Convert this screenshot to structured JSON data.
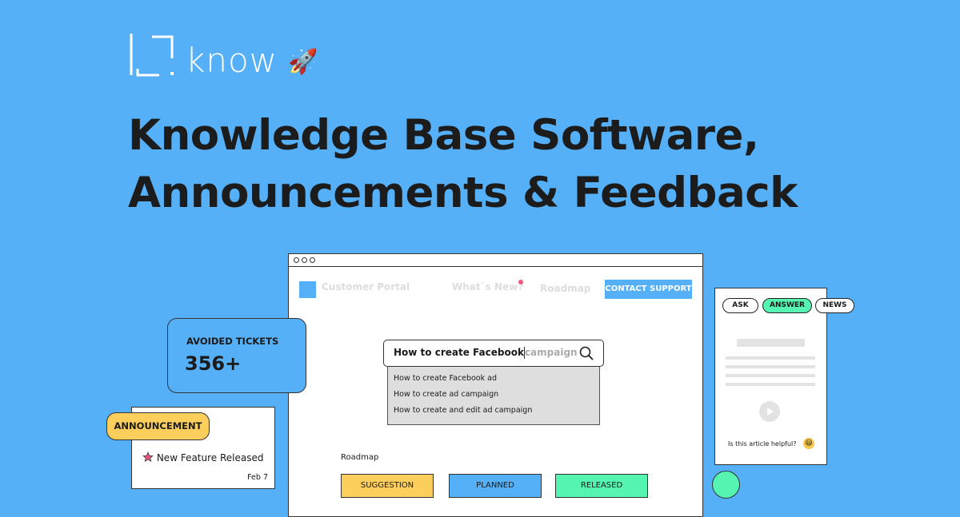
{
  "brand": {
    "logo_text": "know",
    "emoji": "🚀"
  },
  "headline": {
    "line1": "Knowledge Base Software,",
    "line2": "Announcements & Feedback"
  },
  "portal": {
    "nav": {
      "customer_portal": "Customer Portal",
      "whats_new": "What`s New?",
      "roadmap": "Roadmap",
      "contact_support": "CONTACT SUPPORT"
    },
    "search": {
      "typed": "How to create Facebook",
      "suggestion": "campaign"
    },
    "suggestions": [
      "How to create Facebook ad",
      "How to create ad campaign",
      "How to create and edit ad campaign"
    ],
    "roadmap": {
      "label": "Roadmap",
      "statuses": [
        {
          "label": "SUGGESTION",
          "color": "#fcce5b"
        },
        {
          "label": "PLANNED",
          "color": "#55b0f8"
        },
        {
          "label": "RELEASED",
          "color": "#55f5b1"
        }
      ]
    }
  },
  "widget": {
    "tabs": [
      "ASK",
      "ANSWER",
      "NEWS"
    ],
    "active_tab": "ANSWER",
    "helpful_prompt": "Is this article helpful?",
    "emoji": "😃"
  },
  "stats": {
    "label": "AVOIDED TICKETS",
    "value": "356+"
  },
  "announcement": {
    "badge": "ANNOUNCEMENT",
    "title": "New Feature Released",
    "date": "Feb 7"
  },
  "colors": {
    "background": "#55b0f8",
    "yellow": "#fcce5b",
    "green": "#55f5b1",
    "pink": "#f2577a"
  }
}
